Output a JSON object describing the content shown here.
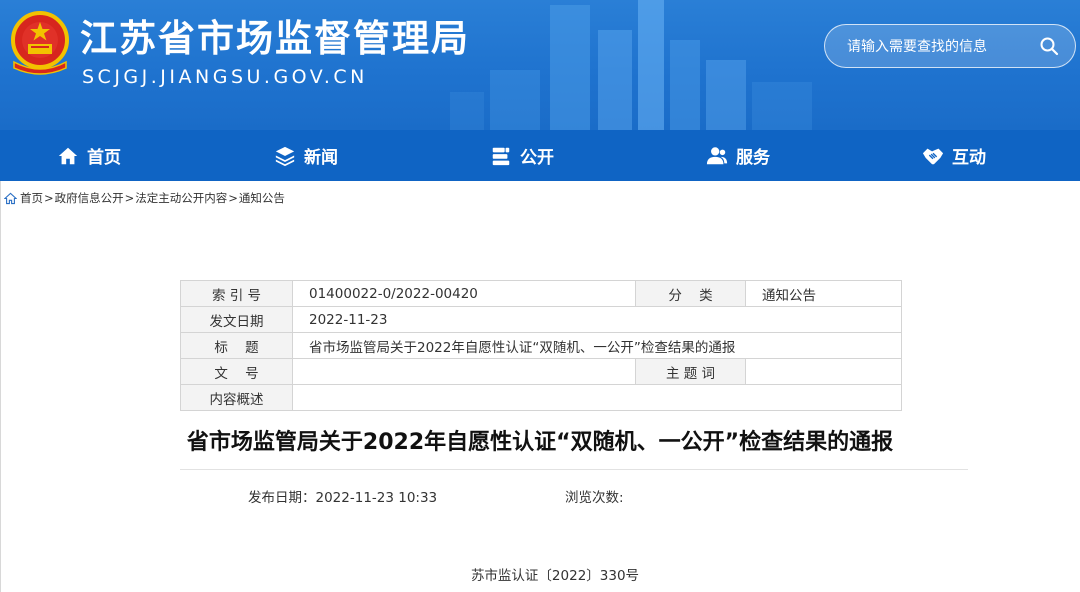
{
  "header": {
    "site_title": "江苏省市场监督管理局",
    "site_url": "SCJGJ.JIANGSU.GOV.CN",
    "search_placeholder": "请输入需要查找的信息"
  },
  "nav": {
    "items": [
      {
        "label": "首页",
        "icon": "home-icon"
      },
      {
        "label": "新闻",
        "icon": "layers-icon"
      },
      {
        "label": "公开",
        "icon": "documents-icon"
      },
      {
        "label": "服务",
        "icon": "people-icon"
      },
      {
        "label": "互动",
        "icon": "handshake-icon"
      }
    ]
  },
  "breadcrumb": {
    "icon": "home-icon",
    "items": [
      "首页",
      "政府信息公开",
      "法定主动公开内容",
      "通知公告"
    ],
    "separator": ">"
  },
  "info_table": {
    "index_label": "索 引 号",
    "index_value": "01400022-0/2022-00420",
    "category_label": "分    类",
    "category_value": "通知公告",
    "date_label": "发文日期",
    "date_value": "2022-11-23",
    "title_label": "标    题",
    "title_value": "省市场监管局关于2022年自愿性认证“双随机、一公开”检查结果的通报",
    "docno_label": "文    号",
    "docno_value": "",
    "subject_label": "主 题 词",
    "subject_value": "",
    "summary_label": "内容概述",
    "summary_value": ""
  },
  "article": {
    "title": "省市场监管局关于2022年自愿性认证“双随机、一公开”检查结果的通报",
    "publish_date": "发布日期：2022-11-23 10:33",
    "views": "浏览次数:",
    "doc_number": "苏市监认证〔2022〕330号"
  },
  "colors": {
    "header_blue": "#2a7fd6",
    "nav_blue": "#0f64c4",
    "table_label_bg": "#f3f3f3",
    "table_border": "#d4d4d4"
  }
}
